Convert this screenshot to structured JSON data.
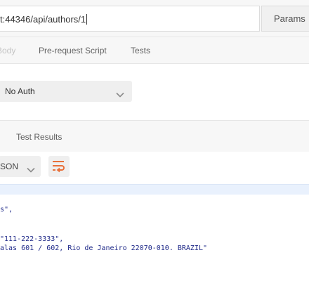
{
  "request": {
    "url": "t:44346/api/authors/1",
    "params_label": "Params"
  },
  "request_tabs": [
    {
      "label": "Body"
    },
    {
      "label": "Pre-request Script"
    },
    {
      "label": "Tests"
    }
  ],
  "auth": {
    "type_value": "No Auth"
  },
  "response": {
    "tabs": [
      {
        "label": "Test Results"
      }
    ],
    "format_value": "SON",
    "wrap_icon": "wrap-lines-icon",
    "lines": [
      {
        "text": "s\","
      },
      {
        "text": "\"111-222-3333\","
      },
      {
        "text": "alas 601 / 602, Rio de Janeiro 22070-010. BRAZIL\""
      }
    ]
  },
  "colors": {
    "accent": "#e8703a",
    "string": "#222c8a",
    "highlight": "#e9f1fd"
  }
}
